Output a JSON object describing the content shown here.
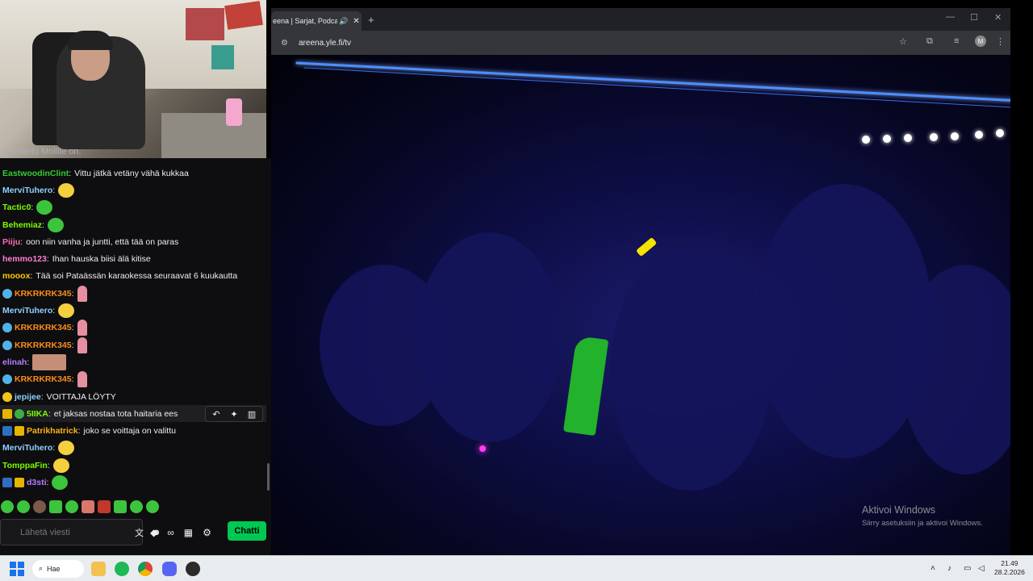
{
  "chat": {
    "cut_text": "ilmoitettu Mollile on.",
    "messages": [
      {
        "user": "EastwoodinClint",
        "color": "#32cd32",
        "text": "Vittu jätkä vetäny vähä kukkaa"
      },
      {
        "user": "MerviTuhero",
        "color": "#8fd0ff",
        "text": ""
      },
      {
        "user": "Tactic0",
        "color": "#7cfc00",
        "text": ""
      },
      {
        "user": "Behemiaz",
        "color": "#7cfc00",
        "text": ""
      },
      {
        "user": "Piiju",
        "color": "#ff69b4",
        "text": "oon niin vanha ja juntti, että tää on paras"
      },
      {
        "user": "hemmo123",
        "color": "#ff7fcf",
        "text": "Ihan hauska biisi älä kitise"
      },
      {
        "user": "mooox",
        "color": "#ffcc00",
        "text": "Tää soi Pataässän karaokessa seuraavat 6 kuukautta"
      },
      {
        "user": "KRKRKRK345",
        "color": "#ff8c1a",
        "text": ""
      },
      {
        "user": "MerviTuhero",
        "color": "#8fd0ff",
        "text": ""
      },
      {
        "user": "KRKRKRK345",
        "color": "#ff8c1a",
        "text": ""
      },
      {
        "user": "KRKRKRK345",
        "color": "#ff8c1a",
        "text": ""
      },
      {
        "user": "elinah",
        "color": "#b57cff",
        "text": ""
      },
      {
        "user": "KRKRKRK345",
        "color": "#ff8c1a",
        "text": ""
      },
      {
        "user": "jepijee",
        "color": "#8fd0ff",
        "text": "VOITTAJA LÖYTY"
      },
      {
        "user": "5IIKA",
        "color": "#7cfc00",
        "text": "et jaksas nostaa tota haitaria ees"
      },
      {
        "user": "Patrikhatrick",
        "color": "#ffb21a",
        "text": "joko se voittaja on valittu"
      },
      {
        "user": "MerviTuhero",
        "color": "#8fd0ff",
        "text": ""
      },
      {
        "user": "TomppaFin",
        "color": "#7cfc00",
        "text": ""
      },
      {
        "user": "d3sti",
        "color": "#b57cff",
        "text": ""
      }
    ],
    "input_placeholder": "Lähetä viesti",
    "chat_button": "Chatti"
  },
  "browser": {
    "tab_title": "eena | Sarjat, Podcast",
    "url": "areena.yle.fi/tv",
    "profile_initial": "M"
  },
  "watermark": {
    "title": "Aktivoi Windows",
    "subtitle": "Siirry asetuksiin ja aktivoi Windows."
  },
  "taskbar": {
    "search_label": "Hae",
    "time": "21.49",
    "date": "28.2.2026"
  }
}
